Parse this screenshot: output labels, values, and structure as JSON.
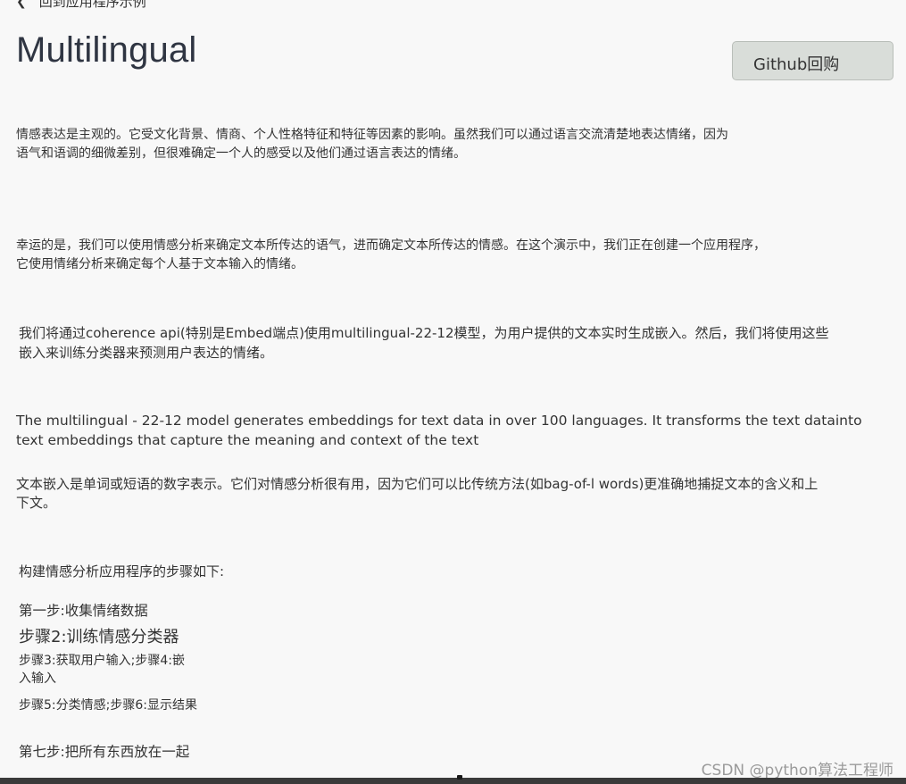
{
  "nav": {
    "back_icon": "chevron-left-icon",
    "back_label": "回到应用程序示例"
  },
  "header": {
    "title": "Multilingual",
    "github_button": "Github回购"
  },
  "content": {
    "p1": "情感表达是主观的。它受文化背景、情商、个人性格特征和特征等因素的影响。虽然我们可以通过语言交流清楚地表达情绪，因为\n语气和语调的细微差别，但很难确定一个人的感受以及他们通过语言表达的情绪。",
    "p2": "幸运的是，我们可以使用情感分析来确定文本所传达的语气，进而确定文本所传达的情感。在这个演示中，我们正在创建一个应用程序，\n它使用情绪分析来确定每个人基于文本输入的情绪。",
    "p3": "我们将通过coherence api(特别是Embed端点)使用multilingual-22-12模型，为用户提供的文本实时生成嵌入。然后，我们将使用这些\n嵌入来训练分类器来预测用户表达的情绪。",
    "p4": "The multilingual - 22-12 model generates embeddings for text data in over 100 languages. It transforms the text datainto\ntext embeddings that capture the meaning and context of the text",
    "p5": "文本嵌入是单词或短语的数字表示。它们对情感分析很有用，因为它们可以比传统方法(如bag-of-l words)更准确地捕捉文本的含义和上\n下文。"
  },
  "steps": {
    "heading": "构建情感分析应用程序的步骤如下:",
    "step1": "第一步:收集情绪数据",
    "step2": "步骤2:训练情感分类器",
    "step34": "步骤3:获取用户输入;步骤4:嵌\n入输入",
    "step56": "步骤5:分类情感;步骤6:显示结果",
    "step7": "第七步:把所有东西放在一起"
  },
  "watermark": "CSDN @python算法工程师"
}
